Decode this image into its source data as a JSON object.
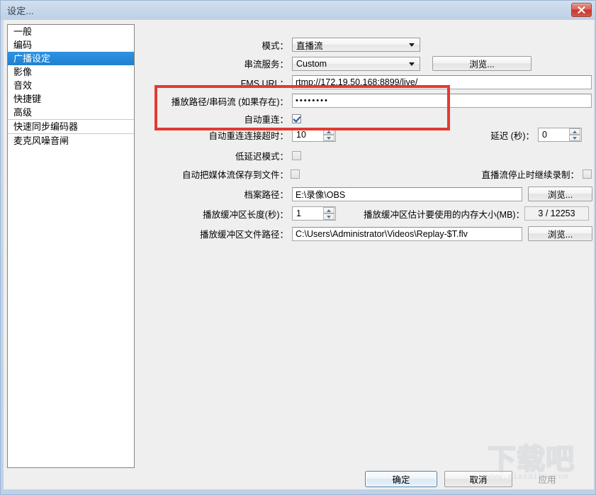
{
  "window": {
    "title": "设定...",
    "close_icon": "close-icon",
    "accent_color": "#2a8fe0",
    "annotation_color": "#e23b32"
  },
  "sidebar": {
    "items": [
      {
        "label": "一般",
        "selected": false,
        "separator": false
      },
      {
        "label": "编码",
        "selected": false,
        "separator": false
      },
      {
        "label": "广播设定",
        "selected": true,
        "separator": false
      },
      {
        "label": "影像",
        "selected": false,
        "separator": false
      },
      {
        "label": "音效",
        "selected": false,
        "separator": false
      },
      {
        "label": "快捷键",
        "selected": false,
        "separator": false
      },
      {
        "label": "高级",
        "selected": false,
        "separator": false
      },
      {
        "label": "快速同步编码器",
        "selected": false,
        "separator": true
      },
      {
        "label": "麦克风噪音闸",
        "selected": false,
        "separator": true
      }
    ]
  },
  "form": {
    "mode": {
      "label": "模式：",
      "value": "直播流"
    },
    "service": {
      "label": "串流服务：",
      "value": "Custom"
    },
    "browse_service": {
      "label": "浏览..."
    },
    "fms_url": {
      "label": "FMS URL：",
      "value": "rtmp://172.19.50.168:8899/live/"
    },
    "stream_key": {
      "label": "播放路径/串码流 (如果存在)：",
      "value": "••••••••"
    },
    "auto_reconnect": {
      "label": "自动重连：",
      "checked": true
    },
    "reconnect_timeout": {
      "label": "自动重连连接超时：",
      "value": "10"
    },
    "delay": {
      "label": "延迟 (秒)：",
      "value": "0"
    },
    "low_latency": {
      "label": "低延迟模式：",
      "checked": false
    },
    "save_stream_to_file": {
      "label": "自动把媒体流保存到文件：",
      "checked": false
    },
    "keep_recording": {
      "label": "直播流停止时继续录制：",
      "checked": false
    },
    "file_path": {
      "label": "档案路径：",
      "value": "E:\\录像\\OBS"
    },
    "browse_file_path": {
      "label": "浏览..."
    },
    "replay_buffer_length": {
      "label": "播放缓冲区长度(秒)：",
      "value": "1"
    },
    "replay_buffer_memory": {
      "label": "播放缓冲区估计要使用的内存大小(MB)：",
      "value": "3 / 12253"
    },
    "replay_buffer_path": {
      "label": "播放缓冲区文件路径：",
      "value": "C:\\Users\\Administrator\\Videos\\Replay-$T.flv"
    },
    "browse_replay_path": {
      "label": "浏览..."
    }
  },
  "footer": {
    "ok": "确定",
    "cancel": "取消",
    "apply": "应用"
  },
  "watermark": {
    "big": "下载吧",
    "small": "www.xiazaiba.com"
  }
}
